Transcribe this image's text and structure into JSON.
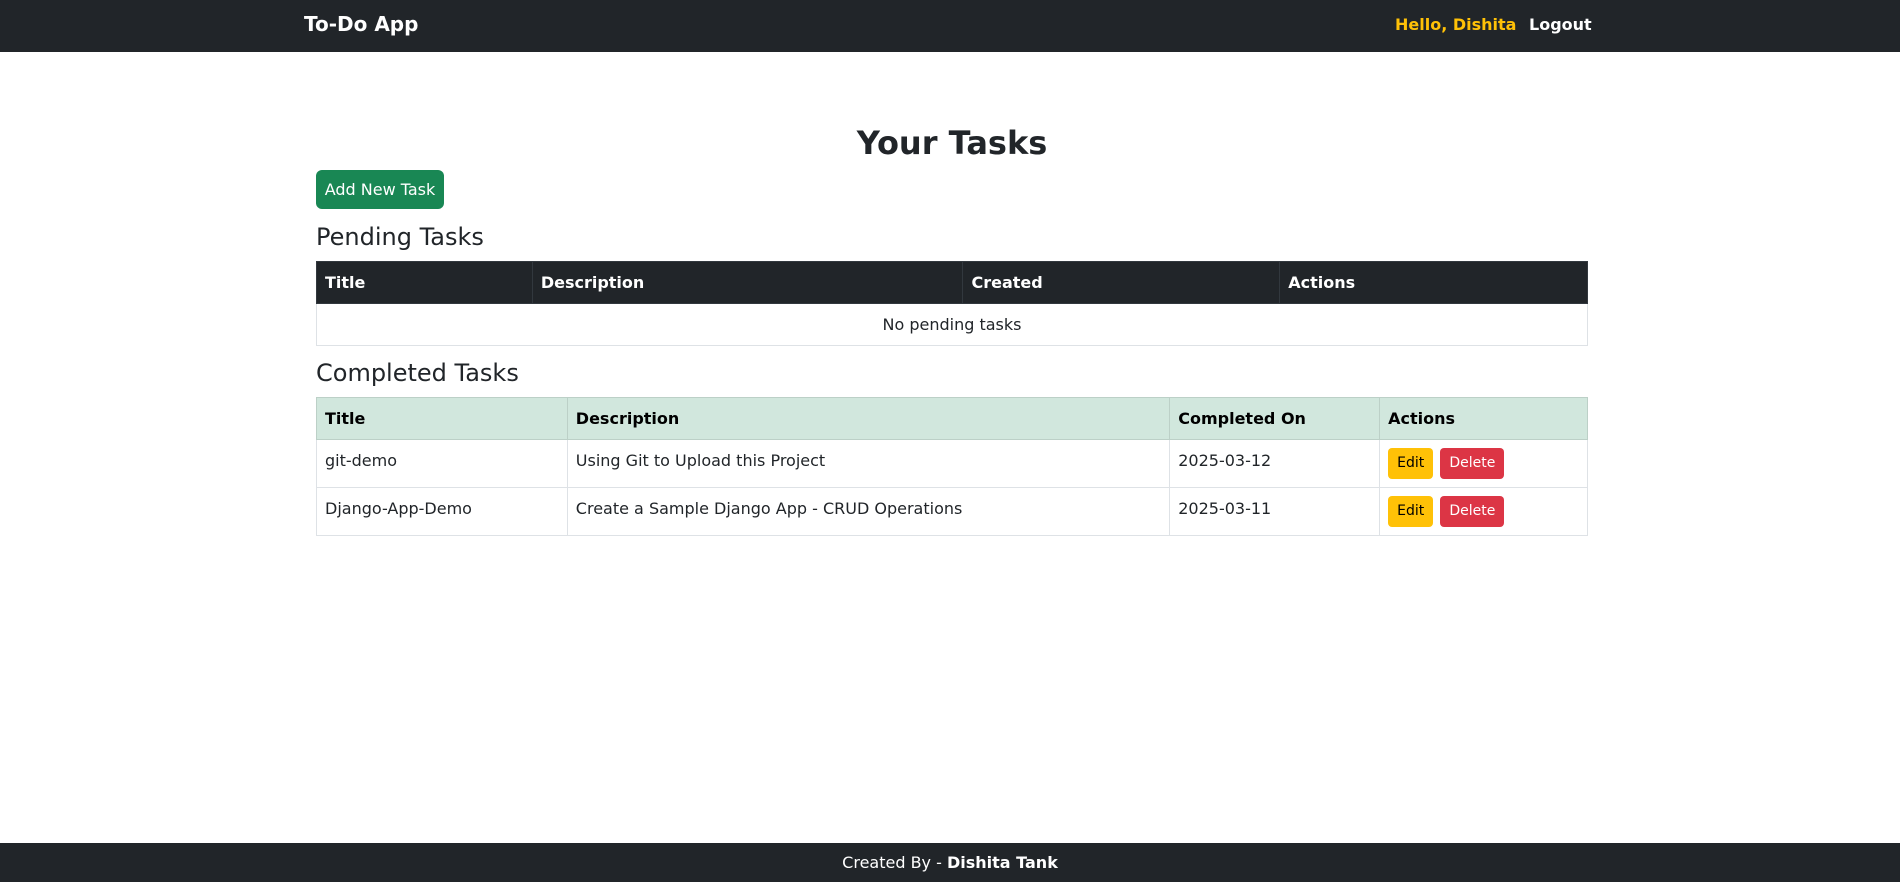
{
  "navbar": {
    "brand": "To-Do App",
    "greeting": "Hello, Dishita",
    "logout_label": "Logout",
    "greeting_color": "#ffc107"
  },
  "main": {
    "title": "Your Tasks",
    "add_task_label": "Add New Task",
    "pending": {
      "title": "Pending Tasks",
      "columns": [
        "Title",
        "Description",
        "Created",
        "Actions"
      ],
      "empty_message": "No pending tasks"
    },
    "completed": {
      "title": "Completed Tasks",
      "columns": [
        "Title",
        "Description",
        "Completed On",
        "Actions"
      ],
      "rows": [
        {
          "title": "git-demo",
          "description": "Using Git to Upload this Project",
          "completed_on": "2025-03-12",
          "edit_label": "Edit",
          "delete_label": "Delete"
        },
        {
          "title": "Django-App-Demo",
          "description": "Create a Sample Django App - CRUD Operations",
          "completed_on": "2025-03-11",
          "edit_label": "Edit",
          "delete_label": "Delete"
        }
      ]
    }
  },
  "footer": {
    "prefix": "Created By - ",
    "author": "Dishita Tank"
  },
  "colors": {
    "navbar_bg": "#212529",
    "add_button": "#198754",
    "edit_button": "#ffc107",
    "delete_button": "#dc3545",
    "completed_header_bg": "#d1e7dd"
  }
}
